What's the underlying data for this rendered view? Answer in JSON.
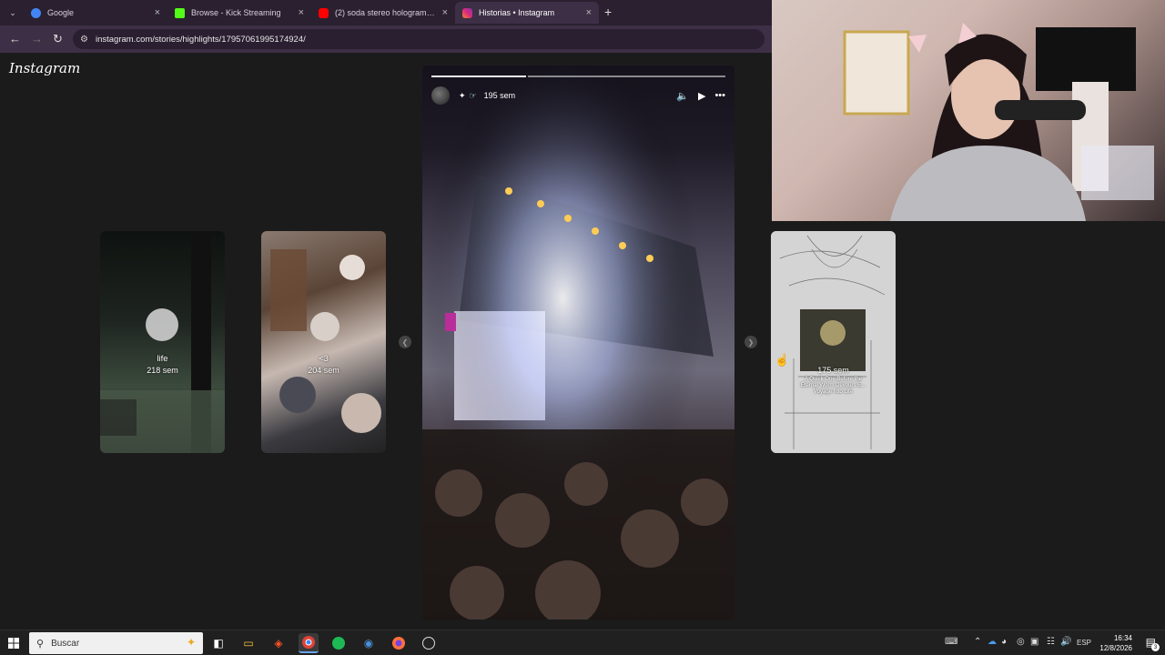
{
  "browser": {
    "tabs": [
      {
        "title": "Google",
        "favicon": "google-icon",
        "color": "#4285f4"
      },
      {
        "title": "Browse - Kick Streaming",
        "favicon": "kick-icon",
        "color": "#53fc18"
      },
      {
        "title": "(2) soda stereo holograma cerc",
        "favicon": "youtube-icon",
        "color": "#ff0000"
      },
      {
        "title": "Historias • Instagram",
        "favicon": "instagram-icon",
        "color": "#e1306c"
      }
    ],
    "url": "instagram.com/stories/highlights/17957061995174924/"
  },
  "instagram": {
    "logo": "Instagram",
    "main_story": {
      "time": "195 sem"
    },
    "left_cards": [
      {
        "name": "life",
        "time": "218 sem"
      },
      {
        "name": "<3",
        "time": "204 sem"
      }
    ],
    "right_card": {
      "time": "175 sem",
      "caption_line1": "A Quick One Before the",
      "caption_line2": "Eternal Worm Devours E...",
      "caption_line3": "Voyage Into Life"
    }
  },
  "taskbar": {
    "search_placeholder": "Buscar",
    "language": "ESP",
    "time": "16:34",
    "date": "12/8/2026",
    "notifications": "3"
  },
  "colors": {
    "accent": "#6aa5e8",
    "chrome_bg": "#3d2f45"
  }
}
